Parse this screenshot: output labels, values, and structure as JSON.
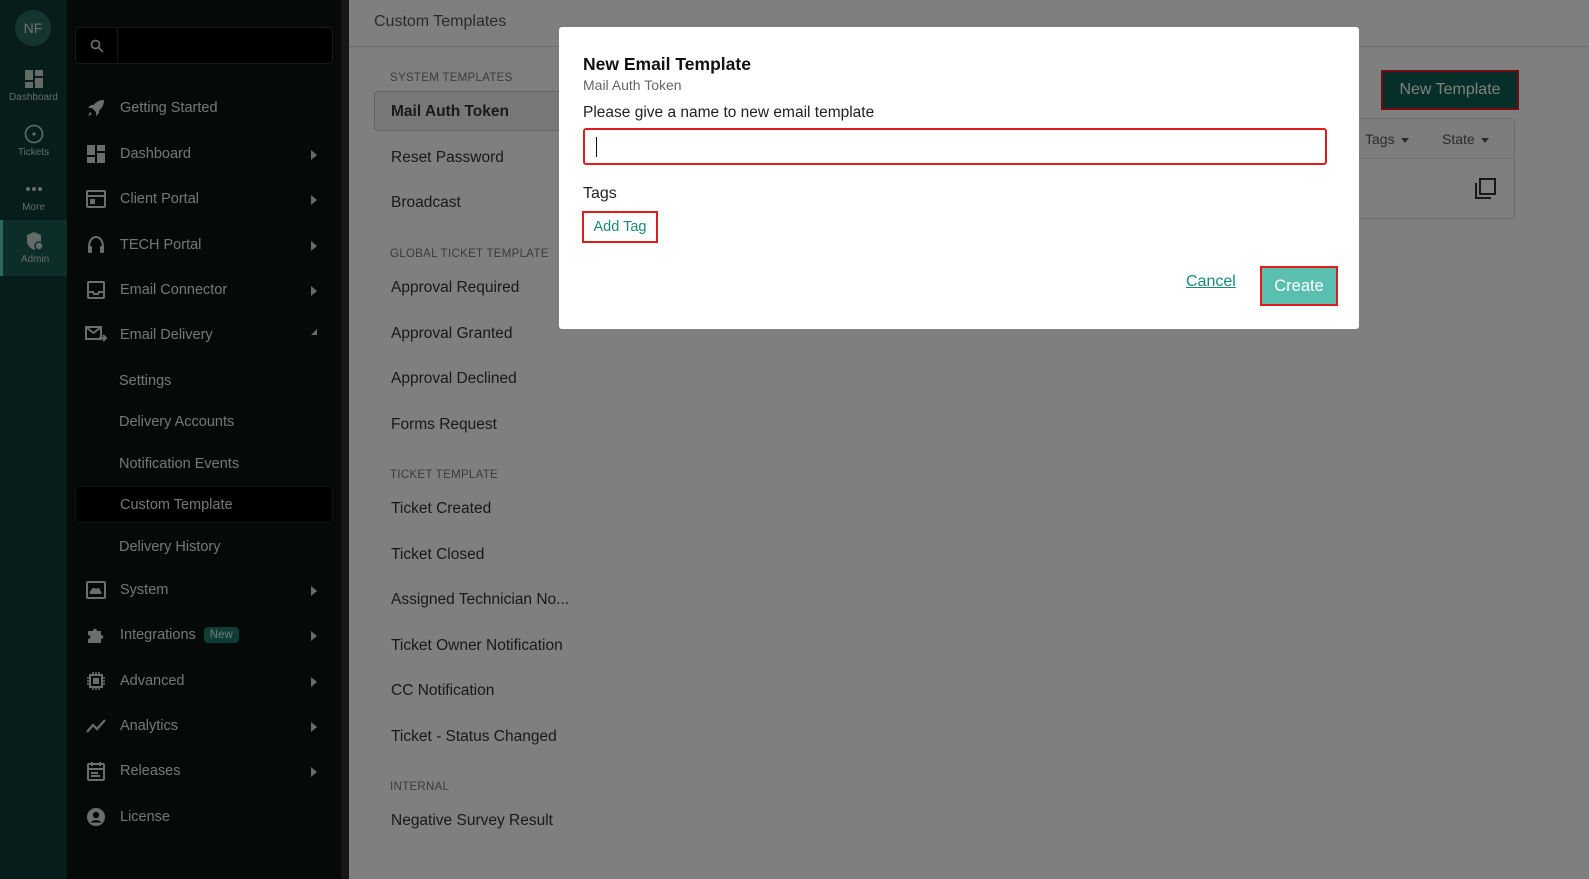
{
  "rail": {
    "avatar_initials": "NF",
    "items": [
      {
        "label": "Dashboard",
        "icon": "dashboard-icon"
      },
      {
        "label": "Tickets",
        "icon": "ticket-circle-icon"
      },
      {
        "label": "More",
        "icon": "more-dots-icon"
      },
      {
        "label": "Admin",
        "icon": "admin-shield-icon",
        "active": true
      }
    ]
  },
  "sidebar": {
    "search_value": "",
    "nav": [
      {
        "label": "Getting Started",
        "icon": "rocket-icon"
      },
      {
        "label": "Dashboard",
        "icon": "dashboard-grid-icon"
      },
      {
        "label": "Client Portal",
        "icon": "browser-window-icon"
      },
      {
        "label": "TECH Portal",
        "icon": "headset-icon"
      },
      {
        "label": "Email Connector",
        "icon": "inbox-icon"
      },
      {
        "label": "Email Delivery",
        "icon": "mail-send-icon"
      }
    ],
    "email_delivery_sub": [
      {
        "label": "Settings"
      },
      {
        "label": "Delivery Accounts"
      },
      {
        "label": "Notification Events"
      },
      {
        "label": "Custom Template",
        "active": true
      },
      {
        "label": "Delivery History"
      }
    ],
    "nav_lower": [
      {
        "label": "System",
        "icon": "cloud-display-icon"
      },
      {
        "label": "Integrations",
        "icon": "puzzle-icon",
        "badge": "New"
      },
      {
        "label": "Advanced",
        "icon": "chip-icon"
      },
      {
        "label": "Analytics",
        "icon": "trend-line-icon"
      },
      {
        "label": "Releases",
        "icon": "calendar-icon"
      },
      {
        "label": "License",
        "icon": "account-circle-icon"
      }
    ]
  },
  "main": {
    "title": "Custom Templates",
    "new_template_label": "New Template",
    "columns": {
      "tags": "Tags",
      "state": "State"
    },
    "sections": [
      {
        "heading": "SYSTEM TEMPLATES",
        "items": [
          "Mail Auth Token",
          "Reset Password",
          "Broadcast"
        ]
      },
      {
        "heading": "GLOBAL TICKET TEMPLATE",
        "items": [
          "Approval Required",
          "Approval Granted",
          "Approval Declined",
          "Forms Request"
        ]
      },
      {
        "heading": "TICKET TEMPLATE",
        "items": [
          "Ticket Created",
          "Ticket Closed",
          "Assigned Technician No...",
          "Ticket Owner Notification",
          "CC Notification",
          "Ticket - Status Changed"
        ]
      },
      {
        "heading": "INTERNAL",
        "items": [
          "Negative Survey Result"
        ]
      }
    ]
  },
  "modal": {
    "title": "New Email Template",
    "subtitle": "Mail Auth Token",
    "name_label": "Please give a name to new email template",
    "name_value": "",
    "tags_label": "Tags",
    "add_tag_label": "Add Tag",
    "cancel_label": "Cancel",
    "create_label": "Create"
  },
  "colors": {
    "rail_bg": "#0c3b34",
    "sidebar_bg": "#0a1512",
    "accent": "#1a8a78",
    "primary_button": "#0f5e52",
    "create_button": "#5bbfb0",
    "highlight_border": "#e01d1d"
  }
}
